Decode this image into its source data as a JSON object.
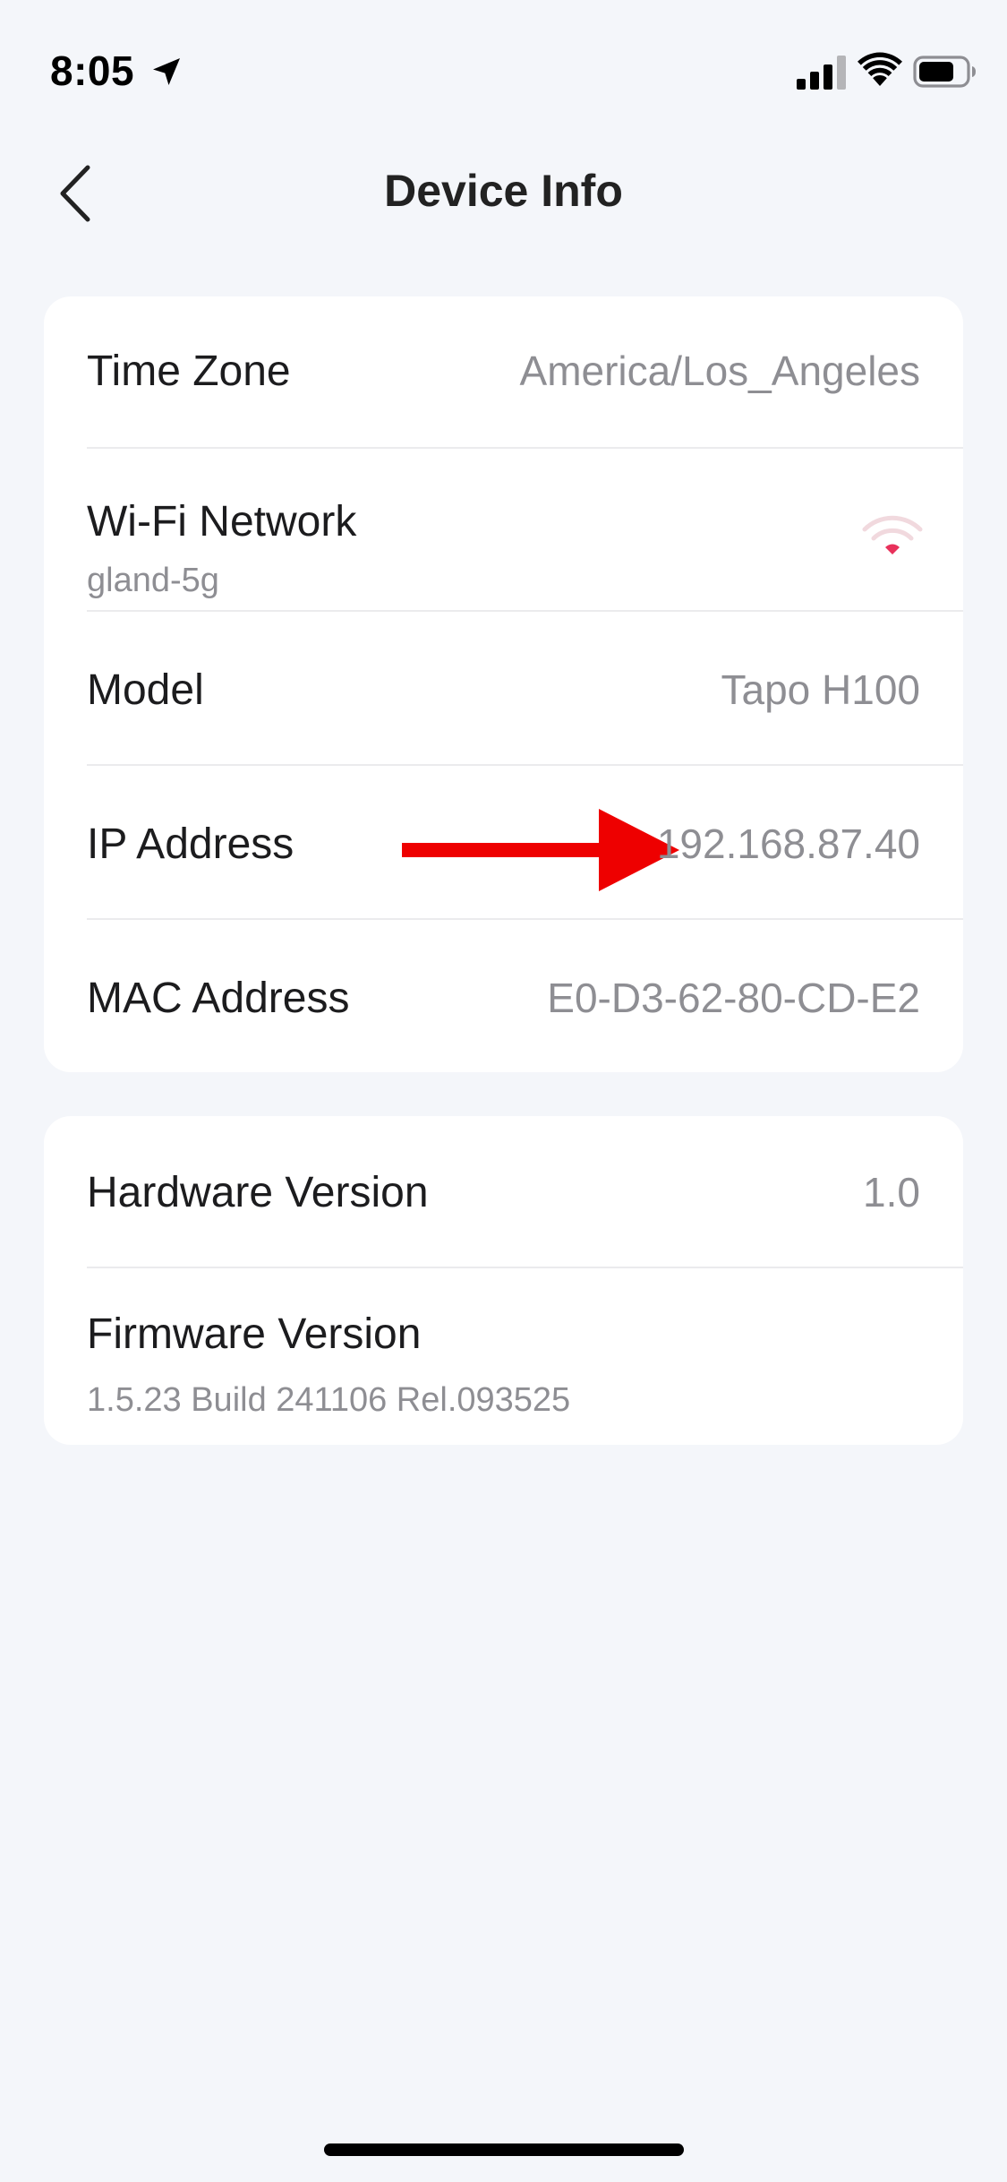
{
  "status_bar": {
    "time": "8:05",
    "icons": [
      "location-arrow-icon",
      "cellular-signal-icon",
      "wifi-icon",
      "battery-icon"
    ]
  },
  "nav": {
    "title": "Device Info",
    "back_icon": "chevron-left-icon"
  },
  "network_card": {
    "rows": [
      {
        "label": "Time Zone",
        "value": "America/Los_Angeles"
      },
      {
        "label": "Wi-Fi Network",
        "sub": "gland-5g",
        "icon": "wifi-signal-icon"
      },
      {
        "label": "Model",
        "value": "Tapo H100"
      },
      {
        "label": "IP Address",
        "value": "192.168.87.40"
      },
      {
        "label": "MAC Address",
        "value": "E0-D3-62-80-CD-E2"
      }
    ]
  },
  "version_card": {
    "rows": [
      {
        "label": "Hardware Version",
        "value": "1.0"
      },
      {
        "label": "Firmware Version",
        "sub": "1.5.23 Build 241106 Rel.093525"
      }
    ]
  },
  "colors": {
    "background": "#f4f6fa",
    "card": "#ffffff",
    "secondary_text": "#8e8e93",
    "wifi_signal_active": "#e8315b",
    "annotation_arrow": "#ee0000"
  }
}
